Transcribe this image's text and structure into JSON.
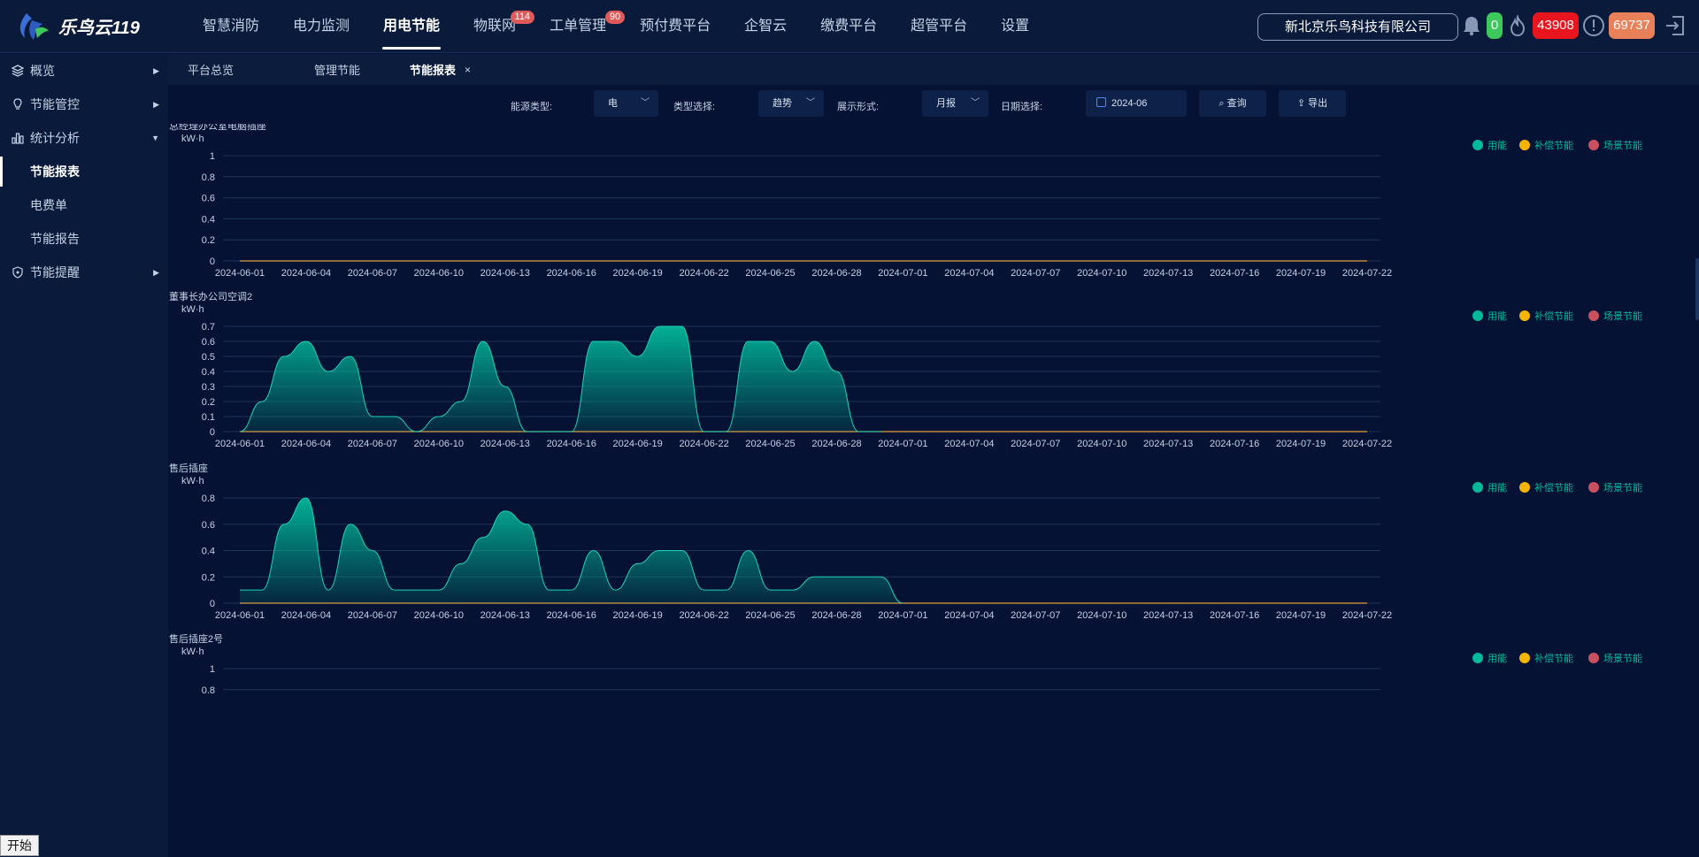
{
  "app": {
    "logo_text": "乐鸟云119",
    "brand_colors": {
      "accent": "#00b89a",
      "compensate": "#f5b400",
      "scene": "#c8505f",
      "bg": "#051233"
    }
  },
  "nav": {
    "items": [
      {
        "label": "智慧消防",
        "badge": null,
        "active": false
      },
      {
        "label": "电力监测",
        "badge": null,
        "active": false
      },
      {
        "label": "用电节能",
        "badge": null,
        "active": true
      },
      {
        "label": "物联网",
        "badge": "114",
        "active": false
      },
      {
        "label": "工单管理",
        "badge": "90",
        "active": false
      },
      {
        "label": "预付费平台",
        "badge": null,
        "active": false
      },
      {
        "label": "企智云",
        "badge": null,
        "active": false
      },
      {
        "label": "缴费平台",
        "badge": null,
        "active": false
      },
      {
        "label": "超管平台",
        "badge": null,
        "active": false
      },
      {
        "label": "设置",
        "badge": null,
        "active": false
      }
    ]
  },
  "header": {
    "company": "新北京乐鸟科技有限公司",
    "bell_count": "0",
    "fire_count": "43908",
    "alert_count": "69737"
  },
  "sidebar": {
    "items": [
      {
        "label": "概览",
        "icon": "layers-icon",
        "expanded": false
      },
      {
        "label": "节能管控",
        "icon": "bulb-icon",
        "expanded": false
      },
      {
        "label": "统计分析",
        "icon": "bar-chart-icon",
        "expanded": true
      },
      {
        "label": "节能提醒",
        "icon": "shield-icon",
        "expanded": false
      }
    ],
    "subitems": [
      {
        "label": "节能报表",
        "active": true
      },
      {
        "label": "电费单",
        "active": false
      },
      {
        "label": "节能报告",
        "active": false
      }
    ]
  },
  "tabs": {
    "items": [
      {
        "label": "平台总览"
      },
      {
        "label": "管理节能"
      },
      {
        "label": "节能报表",
        "close": "×"
      }
    ]
  },
  "filters": {
    "energy_label": "能源类型:",
    "energy_value": "电",
    "type_label": "类型选择:",
    "type_value": "趋势",
    "display_label": "展示形式:",
    "display_value": "月报",
    "date_label": "日期选择:",
    "date_value": "2024-06",
    "query_label": "查询",
    "export_label": "导出"
  },
  "legend": [
    "用能",
    "补偿节能",
    "场景节能"
  ],
  "unit": "kW·h",
  "start_button": "开始",
  "x_ticks": [
    "2024-06-01",
    "2024-06-04",
    "2024-06-07",
    "2024-06-10",
    "2024-06-13",
    "2024-06-16",
    "2024-06-19",
    "2024-06-22",
    "2024-06-25",
    "2024-06-28",
    "2024-07-01",
    "2024-07-04",
    "2024-07-07",
    "2024-07-10",
    "2024-07-13",
    "2024-07-16",
    "2024-07-19",
    "2024-07-22"
  ],
  "chart_data": [
    {
      "type": "area",
      "title": "总经理办公室电脑插座",
      "ylabel": "kW·h",
      "ylim": [
        0,
        1
      ],
      "yticks": [
        "1",
        "0.8",
        "0.6",
        "0.4",
        "0.2",
        "0"
      ],
      "x_range": [
        "2024-06-01",
        "2024-07-22"
      ],
      "legend": "top-right",
      "series": [
        {
          "name": "用能",
          "values": []
        },
        {
          "name": "补偿节能",
          "values": []
        },
        {
          "name": "场景节能",
          "values": []
        }
      ]
    },
    {
      "type": "area",
      "title": "董事长办公司空调2",
      "ylabel": "kW·h",
      "ylim": [
        0,
        0.7
      ],
      "yticks": [
        "0.7",
        "0.6",
        "0.5",
        "0.4",
        "0.3",
        "0.2",
        "0.1",
        "0"
      ],
      "x_range": [
        "2024-06-01",
        "2024-07-22"
      ],
      "legend": "top-right",
      "series": [
        {
          "name": "用能",
          "values": [
            0,
            0.2,
            0.5,
            0.6,
            0.4,
            0.5,
            0.1,
            0.1,
            0,
            0.1,
            0.2,
            0.6,
            0.3,
            0,
            0,
            0,
            0.6,
            0.6,
            0.5,
            0.7,
            0.7,
            0,
            0,
            0.6,
            0.6,
            0.4,
            0.6,
            0.4,
            0,
            0
          ]
        },
        {
          "name": "补偿节能",
          "values": []
        },
        {
          "name": "场景节能",
          "values": []
        }
      ]
    },
    {
      "type": "area",
      "title": "售后插座",
      "ylabel": "kW·h",
      "ylim": [
        0,
        0.8
      ],
      "yticks": [
        "0.8",
        "0.6",
        "0.4",
        "0.2",
        "0"
      ],
      "x_range": [
        "2024-06-01",
        "2024-07-22"
      ],
      "legend": "top-right",
      "series": [
        {
          "name": "用能",
          "values": [
            0.1,
            0.1,
            0.6,
            0.8,
            0.1,
            0.6,
            0.4,
            0.1,
            0.1,
            0.1,
            0.3,
            0.5,
            0.7,
            0.6,
            0.1,
            0.1,
            0.4,
            0.1,
            0.3,
            0.4,
            0.4,
            0.1,
            0.1,
            0.4,
            0.1,
            0.1,
            0.2,
            0.2,
            0.2,
            0.2,
            0
          ]
        },
        {
          "name": "补偿节能",
          "values": []
        },
        {
          "name": "场景节能",
          "values": []
        }
      ]
    },
    {
      "type": "area",
      "title": "售后插座2号",
      "ylabel": "kW·h",
      "ylim": [
        0,
        1
      ],
      "yticks": [
        "1",
        "0.8"
      ],
      "x_range": [
        "2024-06-01",
        "2024-07-22"
      ],
      "legend": "top-right",
      "series": [
        {
          "name": "用能",
          "values": []
        },
        {
          "name": "补偿节能",
          "values": []
        },
        {
          "name": "场景节能",
          "values": []
        }
      ]
    }
  ]
}
